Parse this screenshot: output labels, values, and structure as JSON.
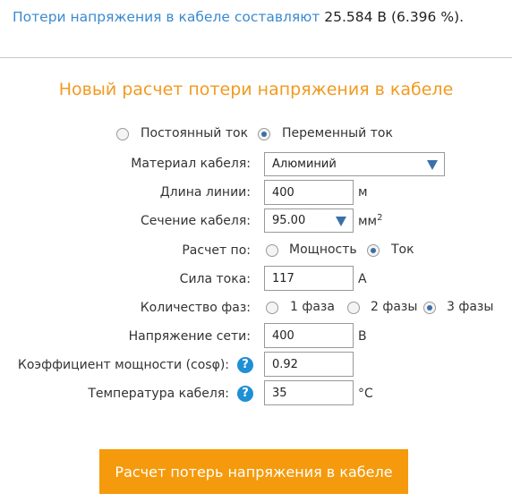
{
  "result": {
    "label": "Потери напряжения в кабеле составляют",
    "value": "25.584 В (6.396 %)."
  },
  "form": {
    "title": "Новый расчет потери напряжения в кабеле",
    "current_type": {
      "options": [
        "Постоянный ток",
        "Переменный ток"
      ],
      "selected": "Переменный ток"
    },
    "material": {
      "label": "Материал кабеля:",
      "value": "Алюминий"
    },
    "length": {
      "label": "Длина линии:",
      "value": "400",
      "unit": "м"
    },
    "section": {
      "label": "Сечение кабеля:",
      "value": "95.00",
      "unit": "мм",
      "unit_sup": "2"
    },
    "calc_by": {
      "label": "Расчет по:",
      "options": [
        "Мощность",
        "Ток"
      ],
      "selected": "Ток"
    },
    "current": {
      "label": "Сила тока:",
      "value": "117",
      "unit": "А"
    },
    "phases": {
      "label": "Количество фаз:",
      "options": [
        "1 фаза",
        "2 фазы",
        "3 фазы"
      ],
      "selected": "3 фазы"
    },
    "voltage": {
      "label": "Напряжение сети:",
      "value": "400",
      "unit": "В"
    },
    "power_factor": {
      "label": "Коэффициент мощности (cosφ):",
      "value": "0.92",
      "help": "?"
    },
    "temperature": {
      "label": "Температура кабеля:",
      "value": "35",
      "unit": "°C",
      "help": "?"
    },
    "submit_label": "Расчет потерь напряжения в кабеле"
  },
  "colors": {
    "accent": "#f59a0c",
    "result_label": "#3a8ad0",
    "radio_selected": "#3b6fa8",
    "help_icon": "#1f8fd6"
  }
}
